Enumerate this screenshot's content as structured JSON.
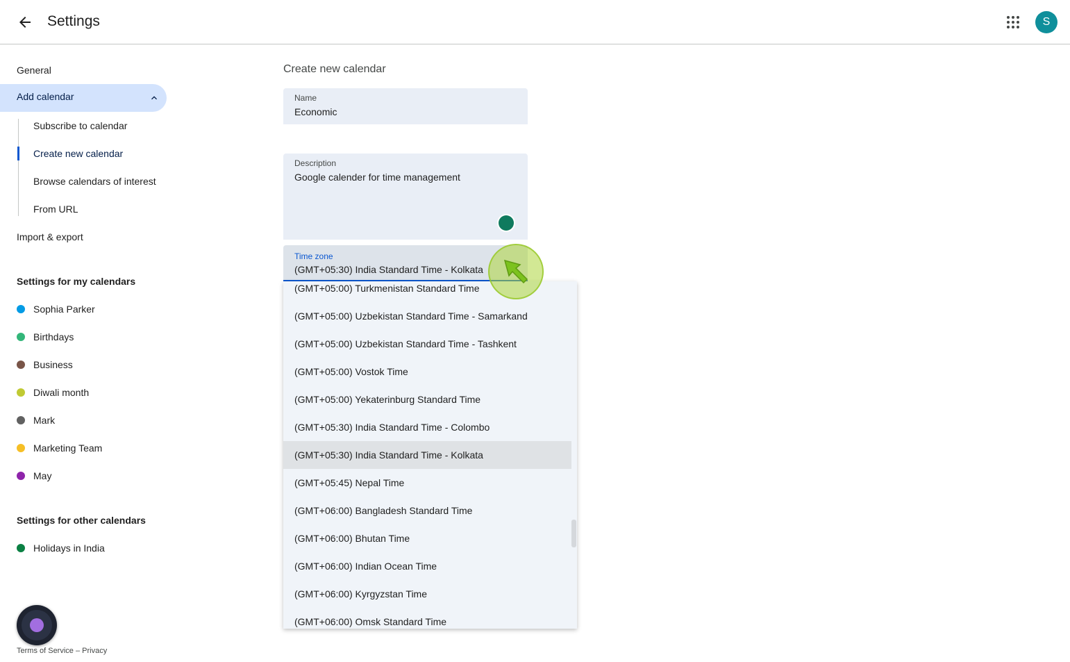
{
  "header": {
    "title": "Settings",
    "avatar_initial": "S",
    "icons": {
      "back": "arrow-left-icon",
      "apps": "apps-grid-icon"
    }
  },
  "sidebar": {
    "general": "General",
    "add_calendar": "Add calendar",
    "sub_items": [
      "Subscribe to calendar",
      "Create new calendar",
      "Browse calendars of interest",
      "From URL"
    ],
    "import_export": "Import & export",
    "my_calendars_title": "Settings for my calendars",
    "my_calendars": [
      {
        "name": "Sophia Parker",
        "color": "#039be5"
      },
      {
        "name": "Birthdays",
        "color": "#33b679"
      },
      {
        "name": "Business",
        "color": "#795548"
      },
      {
        "name": "Diwali month",
        "color": "#c0ca33"
      },
      {
        "name": "Mark",
        "color": "#616161"
      },
      {
        "name": "Marketing Team",
        "color": "#f6bf26"
      },
      {
        "name": "May",
        "color": "#8e24aa"
      }
    ],
    "other_calendars_title": "Settings for other calendars",
    "other_calendars": [
      {
        "name": "Holidays in India",
        "color": "#0b8043"
      }
    ],
    "footer_terms": "Terms of Service",
    "footer_sep": "–",
    "footer_privacy": "Privacy"
  },
  "form": {
    "heading": "Create new calendar",
    "name_label": "Name",
    "name_value": "Economic",
    "description_label": "Description",
    "description_value": "Google calender for time management",
    "timezone_label": "Time zone",
    "timezone_value": "(GMT+05:30) India Standard Time - Kolkata"
  },
  "timezone_options": [
    "(GMT+05:00) Turkmenistan Standard Time",
    "(GMT+05:00) Uzbekistan Standard Time - Samarkand",
    "(GMT+05:00) Uzbekistan Standard Time - Tashkent",
    "(GMT+05:00) Vostok Time",
    "(GMT+05:00) Yekaterinburg Standard Time",
    "(GMT+05:30) India Standard Time - Colombo",
    "(GMT+05:30) India Standard Time - Kolkata",
    "(GMT+05:45) Nepal Time",
    "(GMT+06:00) Bangladesh Standard Time",
    "(GMT+06:00) Bhutan Time",
    "(GMT+06:00) Indian Ocean Time",
    "(GMT+06:00) Kyrgyzstan Time",
    "(GMT+06:00) Omsk Standard Time"
  ],
  "selected_option_index": 6,
  "accent_color": "#0b57d0"
}
